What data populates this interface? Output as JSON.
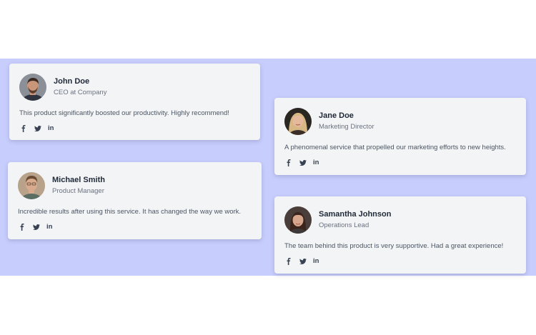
{
  "testimonials": [
    {
      "name": "John Doe",
      "role": "CEO at Company",
      "quote": "This product significantly boosted our productivity. Highly recommend!",
      "avatar_colors": {
        "bg": "#8a8f98",
        "skin": "#c9967a",
        "hair": "#3b2a22",
        "shirt": "#2f3440"
      }
    },
    {
      "name": "Michael Smith",
      "role": "Product Manager",
      "quote": "Incredible results after using this service. It has changed the way we work.",
      "avatar_colors": {
        "bg": "#b9a28a",
        "skin": "#d9ab8e",
        "hair": "#6a4b33",
        "shirt": "#5b6e63"
      }
    },
    {
      "name": "Jane Doe",
      "role": "Marketing Director",
      "quote": "A phenomenal service that propelled our marketing efforts to new heights.",
      "avatar_colors": {
        "bg": "#2a2621",
        "skin": "#e4b99c",
        "hair": "#d7b783",
        "shirt": "#3a2f28"
      }
    },
    {
      "name": "Samantha Johnson",
      "role": "Operations Lead",
      "quote": "The team behind this product is very supportive. Had a great experience!",
      "avatar_colors": {
        "bg": "#4a3e3a",
        "skin": "#d7a78d",
        "hair": "#3a241b",
        "shirt": "#3f3a3a"
      }
    }
  ],
  "social": {
    "icons": [
      "facebook-icon",
      "twitter-icon",
      "linkedin-icon"
    ],
    "linkedin_label": "in"
  },
  "colors": {
    "band": "#c7cdfd",
    "card": "#f3f4f6",
    "icon": "#374151"
  }
}
